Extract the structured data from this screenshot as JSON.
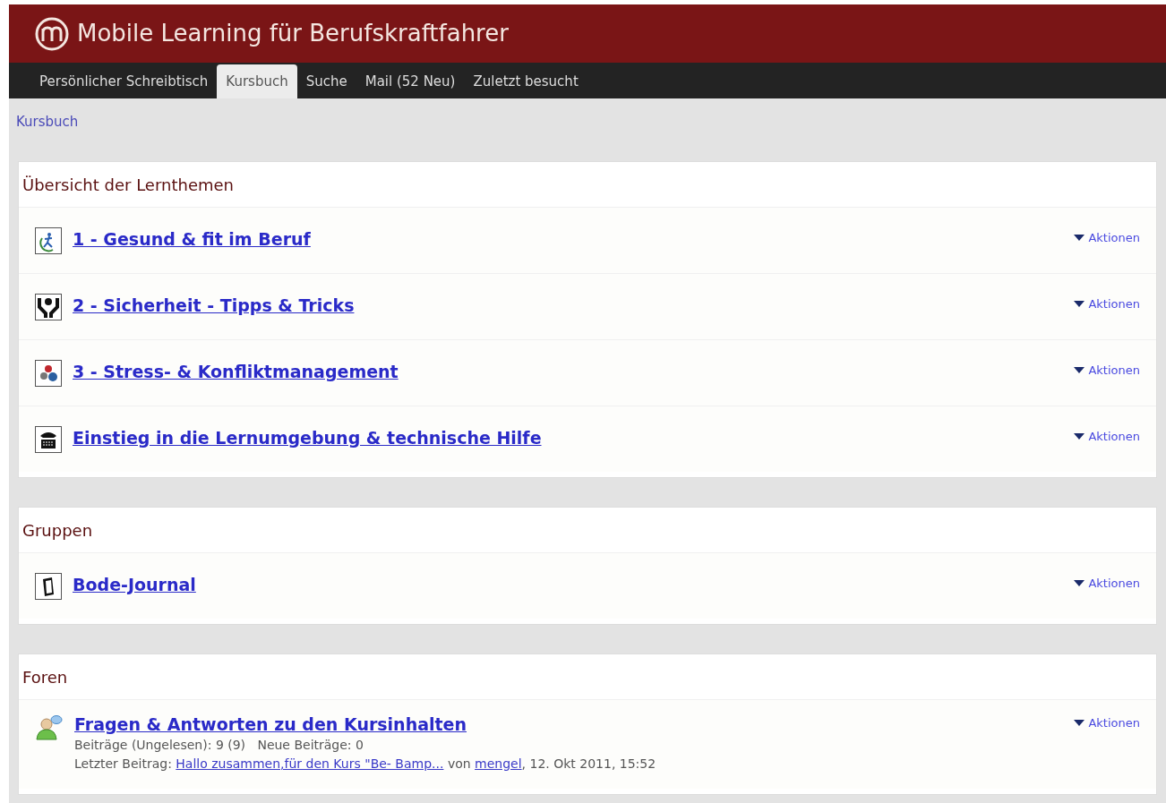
{
  "header": {
    "title": "Mobile Learning für Berufskraftfahrer"
  },
  "tabs": [
    {
      "label": "Persönlicher Schreibtisch",
      "selected": false
    },
    {
      "label": "Kursbuch",
      "selected": true
    },
    {
      "label": "Suche",
      "selected": false
    },
    {
      "label": "Mail (52 Neu)",
      "selected": false
    },
    {
      "label": "Zuletzt besucht",
      "selected": false
    }
  ],
  "breadcrumb": "Kursbuch",
  "sections": [
    {
      "title": "Übersicht der Lernthemen",
      "items": [
        {
          "title": "1 - Gesund & fit im Beruf",
          "actions": "Aktionen"
        },
        {
          "title": "2 - Sicherheit - Tipps & Tricks",
          "actions": "Aktionen"
        },
        {
          "title": "3 - Stress- & Konfliktmanagement",
          "actions": "Aktionen"
        },
        {
          "title": "Einstieg in die Lernumgebung & technische Hilfe",
          "actions": "Aktionen"
        }
      ]
    },
    {
      "title": "Gruppen",
      "items": [
        {
          "title": "Bode-Journal",
          "actions": "Aktionen"
        }
      ]
    },
    {
      "title": "Foren",
      "items": [
        {
          "title": "Fragen & Antworten zu den Kursinhalten",
          "actions": "Aktionen",
          "stats": "Beiträge (Ungelesen): 9 (9)   Neue Beiträge: 0",
          "last_post": {
            "label": "Letzter Beitrag:",
            "link": "Hallo zusammen,für den Kurs \"Be- Bamp...",
            "by": "von",
            "author": "mengel",
            "date": ", 12. Okt 2011, 15:52"
          }
        }
      ]
    }
  ]
}
